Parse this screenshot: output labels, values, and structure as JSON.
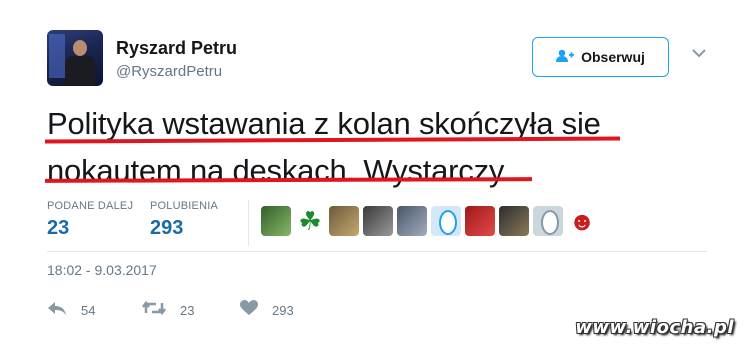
{
  "author": {
    "name": "Ryszard Petru",
    "handle": "@RyszardPetru"
  },
  "follow_button": {
    "label": "Obserwuj",
    "icon": "add-user-icon"
  },
  "menu_icon": "chevron-down-icon",
  "tweet": {
    "text": "Polityka wstawania z kolan skończyła sie nokautem na deskach. Wystarczy"
  },
  "stats": {
    "retweets_label": "PODANE DALEJ",
    "retweets_value": "23",
    "likes_label": "POLUBIENIA",
    "likes_value": "293"
  },
  "timestamp": "18:02 - 9.03.2017",
  "actions": {
    "reply_count": "54",
    "retweet_count": "23",
    "like_count": "293"
  },
  "watermark": "www.wiocha.pl",
  "colors": {
    "accent": "#1da1f2",
    "stat_value": "#1b6ba8",
    "underline": "#e0151e",
    "muted_text": "#657786"
  }
}
